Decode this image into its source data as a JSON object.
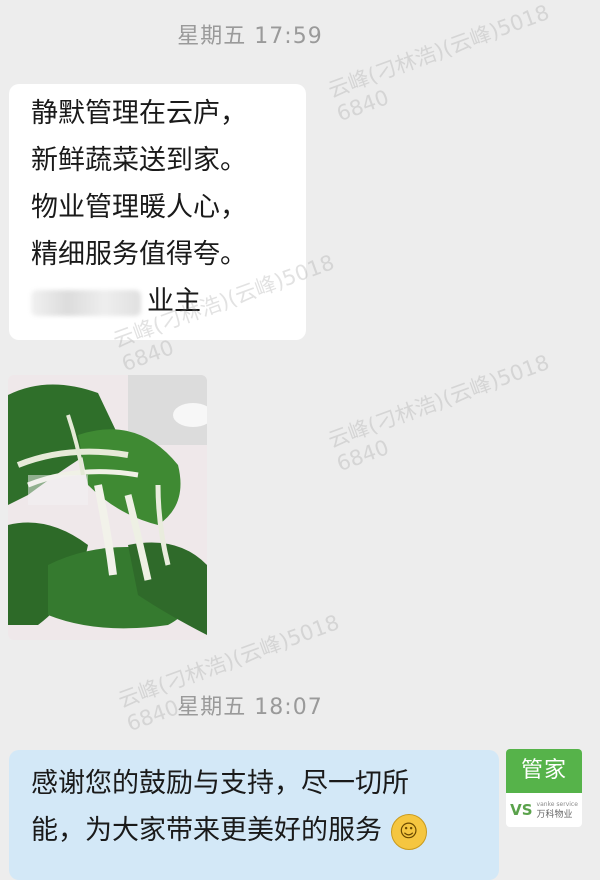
{
  "chat": {
    "timestamp_1": "星期五  17:59",
    "timestamp_2": "星期五  18:07",
    "message_1": {
      "lines": [
        "静默管理在云庐，",
        "新鲜蔬菜送到家。",
        "物业管理暖人心，",
        "精细服务值得夸。"
      ],
      "signature_suffix": "业主"
    },
    "photo": {
      "description_icon": "vegetable-photo"
    },
    "message_2": {
      "line_1": "感谢您的鼓励与支持，尽一切所",
      "line_2": "能，为大家带来更美好的服务"
    },
    "avatar": {
      "label": "管家",
      "logo_mark": "VS",
      "logo_small": "vanke service",
      "logo_brand": "万科物业"
    }
  },
  "watermark": {
    "line_1": "云峰(刁林浩)(云峰)5018",
    "line_2": "6840"
  },
  "colors": {
    "background": "#ededed",
    "bubble_in": "#ffffff",
    "bubble_out": "#d3e8f7",
    "avatar_green": "#56b34a"
  }
}
